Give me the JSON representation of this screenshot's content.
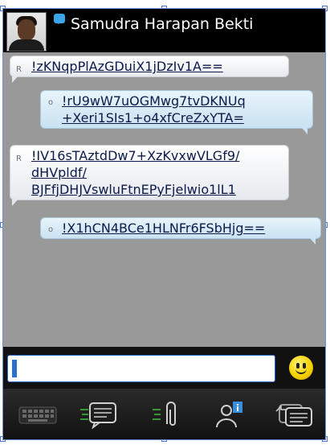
{
  "header": {
    "contact_name": "Samudra Harapan Bekti"
  },
  "messages": [
    {
      "direction": "in",
      "status": "R",
      "lines": [
        "!zKNqpPlAzGDuiX1jDzIv1A=="
      ]
    },
    {
      "direction": "out",
      "status": "o",
      "lines": [
        "!rU9wW7uOGMwg7tvDKNUq",
        "+Xeri1SIs1+o4xfCreZxYTA="
      ]
    },
    {
      "direction": "in",
      "status": "R",
      "lines": [
        "!IV16sTAztdDw7+XzKvxwVLGf9/",
        "dHVpldf/",
        "BJFfjDHJVswluFtnEPyFjelwio1lL1"
      ]
    },
    {
      "direction": "out",
      "status": "o",
      "lines": [
        "!X1hCN4BCe1HLNFr6FSbHjg=="
      ]
    }
  ],
  "input": {
    "value": ""
  },
  "colors": {
    "header_bg": "#000000",
    "chat_bg": "#9a999a",
    "incoming_bubble": "#e6e9ee",
    "outgoing_bubble": "#c9e2f1",
    "accent": "#2b6fd1"
  },
  "toolbar": {
    "icons": [
      "keyboard-icon",
      "new-message-icon",
      "attachment-icon",
      "contact-info-icon",
      "switch-chat-icon"
    ]
  }
}
